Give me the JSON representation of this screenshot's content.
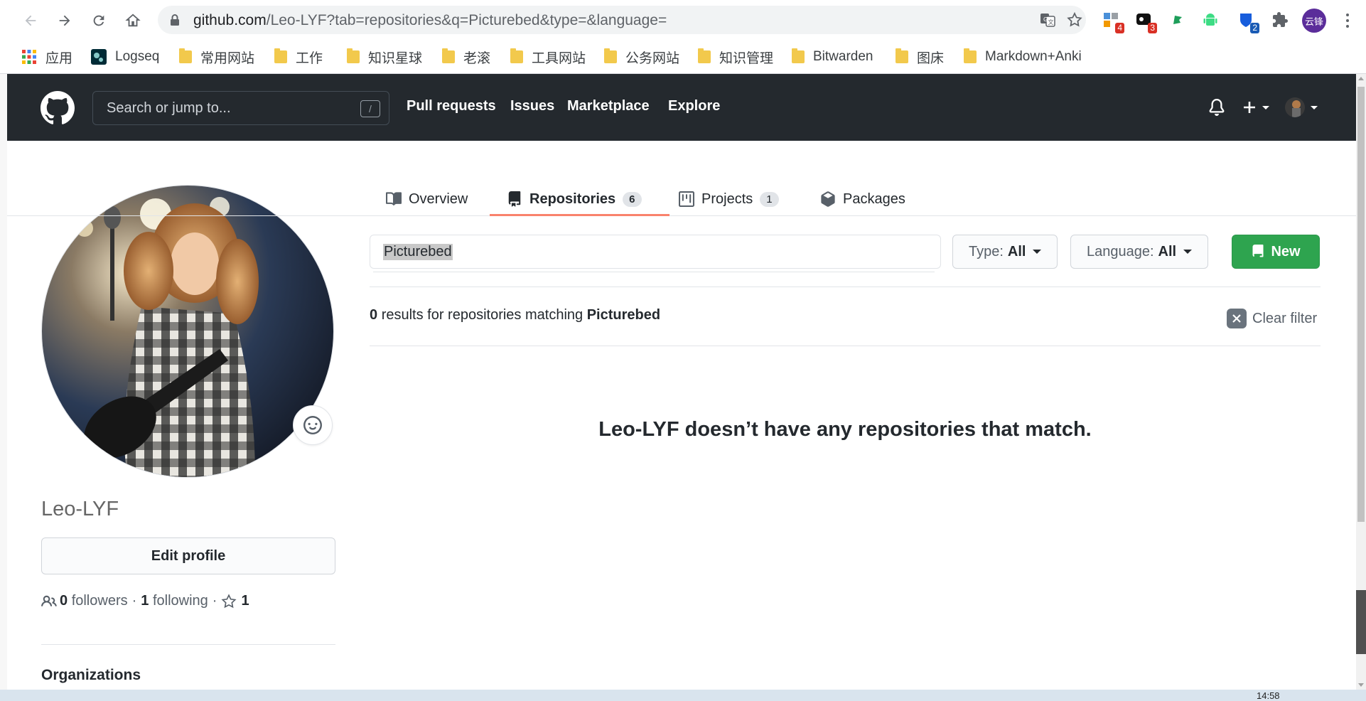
{
  "browser": {
    "url_host": "github.com",
    "url_path": "/Leo-LYF?tab=repositories&q=Picturebed&type=&language=",
    "extension_badges": [
      "4",
      "3",
      "2"
    ],
    "profile_label": "云锋"
  },
  "bookmarks": [
    {
      "label": "应用",
      "icon": "apps-grid-icon"
    },
    {
      "label": "Logseq",
      "icon": "logseq-icon"
    },
    {
      "label": "常用网站",
      "icon": "folder-icon"
    },
    {
      "label": "工作",
      "icon": "folder-icon"
    },
    {
      "label": "知识星球",
      "icon": "folder-icon"
    },
    {
      "label": "老滚",
      "icon": "folder-icon"
    },
    {
      "label": "工具网站",
      "icon": "folder-icon"
    },
    {
      "label": "公务网站",
      "icon": "folder-icon"
    },
    {
      "label": "知识管理",
      "icon": "folder-icon"
    },
    {
      "label": "Bitwarden",
      "icon": "folder-icon"
    },
    {
      "label": "图床",
      "icon": "folder-icon"
    },
    {
      "label": "Markdown+Anki",
      "icon": "folder-icon"
    }
  ],
  "header": {
    "search_placeholder": "Search or jump to...",
    "search_shortcut": "/",
    "nav": [
      "Pull requests",
      "Issues",
      "Marketplace",
      "Explore"
    ]
  },
  "profile": {
    "username": "Leo-LYF",
    "edit_label": "Edit profile",
    "followers_count": "0",
    "followers_label": "followers",
    "following_count": "1",
    "following_label": "following",
    "stars_count": "1",
    "orgs_heading": "Organizations"
  },
  "tabs": [
    {
      "label": "Overview",
      "icon": "book-icon"
    },
    {
      "label": "Repositories",
      "count": "6",
      "icon": "repo-icon",
      "selected": true
    },
    {
      "label": "Projects",
      "count": "1",
      "icon": "project-icon"
    },
    {
      "label": "Packages",
      "icon": "package-icon"
    }
  ],
  "filters": {
    "query": "Picturebed",
    "type_label": "Type:",
    "type_value": "All",
    "language_label": "Language:",
    "language_value": "All",
    "new_label": "New"
  },
  "results": {
    "count": "0",
    "text": "results for repositories matching",
    "query": "Picturebed",
    "clear_label": "Clear filter",
    "blank_message": "Leo-LYF doesn’t have any repositories that match."
  },
  "taskbar": {
    "clock": "14:58"
  },
  "colors": {
    "header_bg": "#24292e",
    "new_button": "#2ea44f",
    "tab_underline": "#f9826c"
  }
}
